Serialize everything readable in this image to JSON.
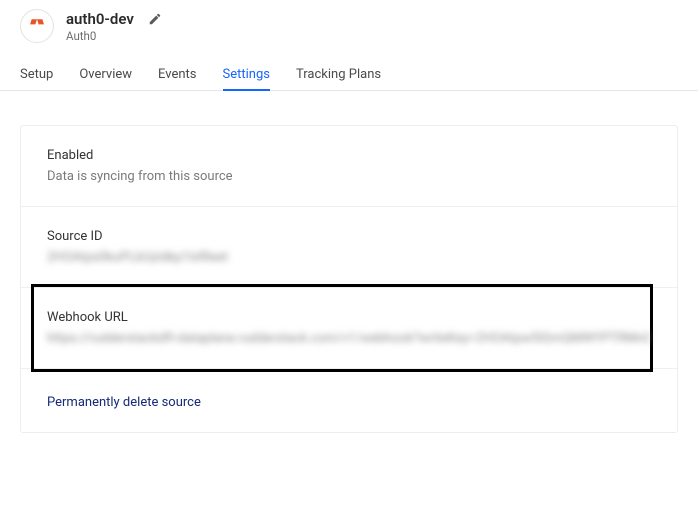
{
  "header": {
    "title": "auth0-dev",
    "subtitle": "Auth0"
  },
  "tabs": [
    {
      "label": "Setup",
      "active": false
    },
    {
      "label": "Overview",
      "active": false
    },
    {
      "label": "Events",
      "active": false
    },
    {
      "label": "Settings",
      "active": true
    },
    {
      "label": "Tracking Plans",
      "active": false
    }
  ],
  "settings": {
    "enabled": {
      "heading": "Enabled",
      "description": "Data is syncing from this source"
    },
    "source_id": {
      "heading": "Source ID",
      "value": "2HOAtps0kuPLbUyIdkp1lxRleet"
    },
    "webhook": {
      "heading": "Webhook URL",
      "value": "https://rudderstackdft-dataplane.rudderstack.com/v1/webhook?writeKey=2HOAtpw5IGmQMWYPTRMnCcv23k"
    },
    "delete": {
      "label": "Permanently delete source"
    }
  }
}
